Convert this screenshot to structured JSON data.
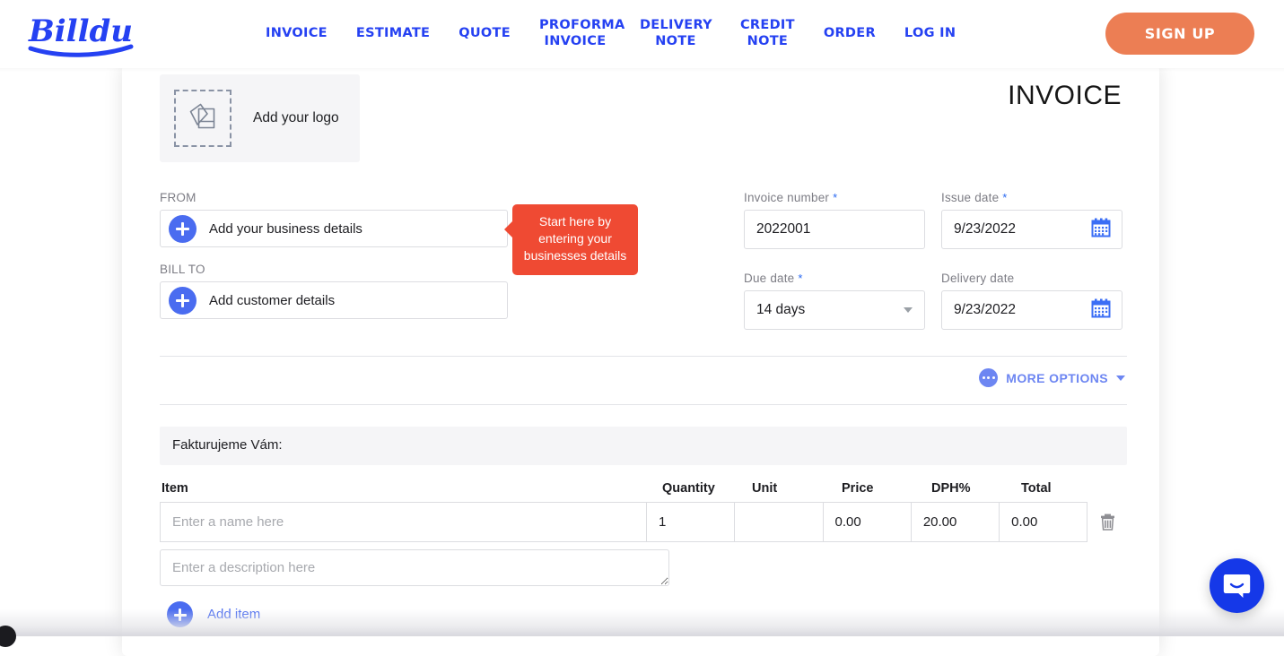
{
  "nav": {
    "logo_text": "Billdu",
    "links": [
      {
        "label": "INVOICE",
        "name": "nav-link-invoice"
      },
      {
        "label": "ESTIMATE",
        "name": "nav-link-estimate"
      },
      {
        "label": "QUOTE",
        "name": "nav-link-quote"
      },
      {
        "label": "PROFORMA\nINVOICE",
        "name": "nav-link-proforma-invoice"
      },
      {
        "label": "DELIVERY\nNOTE",
        "name": "nav-link-delivery-note"
      },
      {
        "label": "CREDIT\nNOTE",
        "name": "nav-link-credit-note"
      },
      {
        "label": "ORDER",
        "name": "nav-link-order"
      },
      {
        "label": "LOG IN",
        "name": "nav-link-log-in"
      }
    ],
    "signup_label": "SIGN UP",
    "link_color": "#2541f2",
    "signup_color": "#ec7e54"
  },
  "invoice": {
    "logo_upload_label": "Add your logo",
    "document_title": "INVOICE",
    "from": {
      "label": "FROM",
      "add_label": "Add your business details"
    },
    "bill_to": {
      "label": "BILL TO",
      "add_label": "Add customer details"
    },
    "tooltip": {
      "text": "Start here by entering your businesses details",
      "color": "#ef4a33"
    },
    "fields": {
      "invoice_number": {
        "label": "Invoice number",
        "required_mark": "*",
        "value": "2022001"
      },
      "issue_date": {
        "label": "Issue date",
        "required_mark": "*",
        "value": "9/23/2022"
      },
      "due_date": {
        "label": "Due date",
        "required_mark": "*",
        "value": "14 days"
      },
      "delivery_date": {
        "label": "Delivery date",
        "required_mark": "",
        "value": "9/23/2022"
      }
    },
    "more_options_label": "MORE OPTIONS",
    "note": {
      "value": "Fakturujeme Vám:",
      "placeholder": ""
    },
    "items_table": {
      "headers": [
        "Item",
        "Quantity",
        "Unit",
        "Price",
        "DPH%",
        "Total"
      ],
      "rows": [
        {
          "item_placeholder": "Enter a name here",
          "item_value": "",
          "quantity": "1",
          "unit": "",
          "price": "0.00",
          "dph": "20.00",
          "total": "0.00",
          "description_placeholder": "Enter a description here",
          "description_value": ""
        }
      ]
    },
    "add_item_label": "Add item"
  },
  "chat": {
    "launcher_name": "intercom-chat-launcher",
    "color": "#1538e8"
  }
}
